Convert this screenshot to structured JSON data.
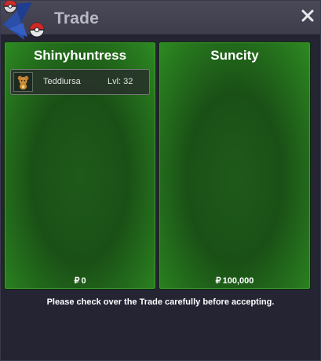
{
  "window": {
    "title": "Trade",
    "close_icon": "close-icon"
  },
  "left_panel": {
    "name": "Shinyhuntress",
    "items": [
      {
        "name": "Teddiursa",
        "level": "Lvl: 32",
        "icon": "teddiursa-icon"
      }
    ],
    "currency_symbol": "₽",
    "money": "0"
  },
  "right_panel": {
    "name": "Suncity",
    "items": [],
    "currency_symbol": "₽",
    "money": "100,000"
  },
  "notice": "Please check over the Trade carefully before accepting.",
  "colors": {
    "panel_green": "#1f5a1a",
    "panel_edge": "#2d8a22",
    "window_bg": "#252433",
    "titlebar": "#45444f"
  }
}
